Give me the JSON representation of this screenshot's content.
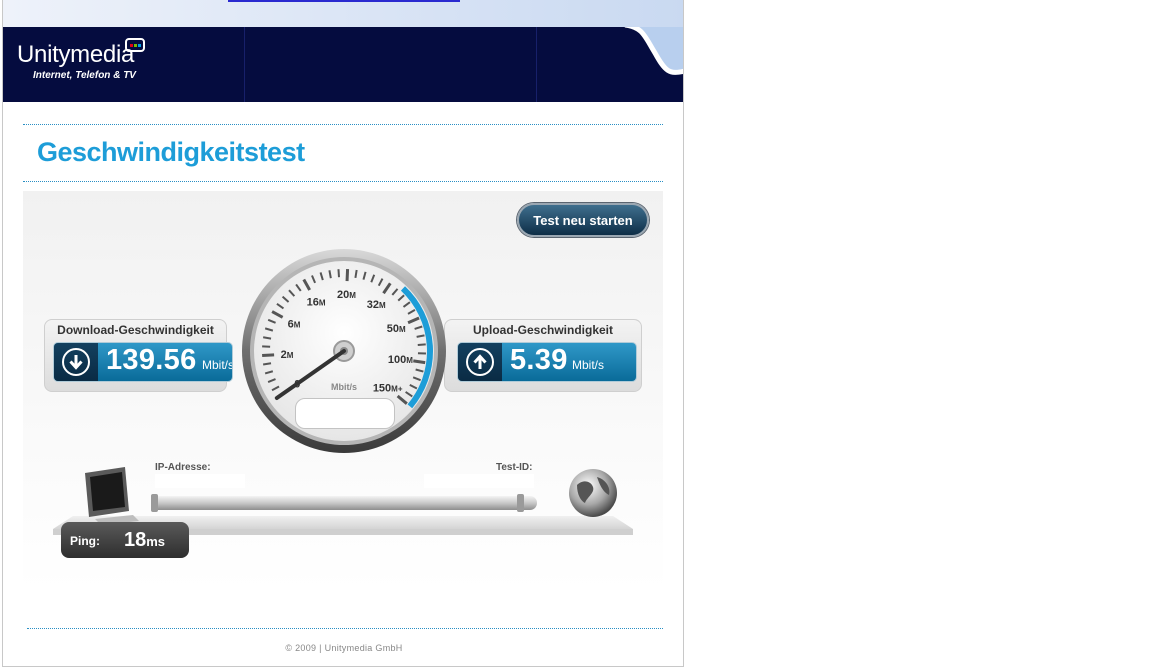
{
  "brand": {
    "name": "Unitymedia",
    "tagline": "Internet, Telefon & TV",
    "bubble_colors": [
      "#e2001a",
      "#7ab800",
      "#009fe3"
    ]
  },
  "page": {
    "title": "Geschwindigkeitstest"
  },
  "toolbar": {
    "restart_label": "Test neu starten"
  },
  "download": {
    "label": "Download-Geschwindigkeit",
    "value": "139.56",
    "unit": "Mbit/s",
    "icon": "arrow-down-circle-icon"
  },
  "upload": {
    "label": "Upload-Geschwindigkeit",
    "value": "5.39",
    "unit": "Mbit/s",
    "icon": "arrow-up-circle-icon"
  },
  "gauge": {
    "unit": "Mbit/s",
    "ticks": [
      {
        "label": "0",
        "suffix": ""
      },
      {
        "label": "2",
        "suffix": "M"
      },
      {
        "label": "6",
        "suffix": "M"
      },
      {
        "label": "16",
        "suffix": "M"
      },
      {
        "label": "20",
        "suffix": "M"
      },
      {
        "label": "32",
        "suffix": "M"
      },
      {
        "label": "50",
        "suffix": "M"
      },
      {
        "label": "100",
        "suffix": "M"
      },
      {
        "label": "150",
        "suffix": "M+"
      }
    ],
    "needle_value": "0",
    "accent": "#1d9dd8"
  },
  "network": {
    "ip_label": "IP-Adresse:",
    "ip_value": "",
    "test_id_label": "Test-ID:",
    "test_id_value": ""
  },
  "ping": {
    "label": "Ping:",
    "value": "18",
    "unit": "ms"
  },
  "footer": {
    "text": "© 2009 | Unitymedia GmbH"
  }
}
